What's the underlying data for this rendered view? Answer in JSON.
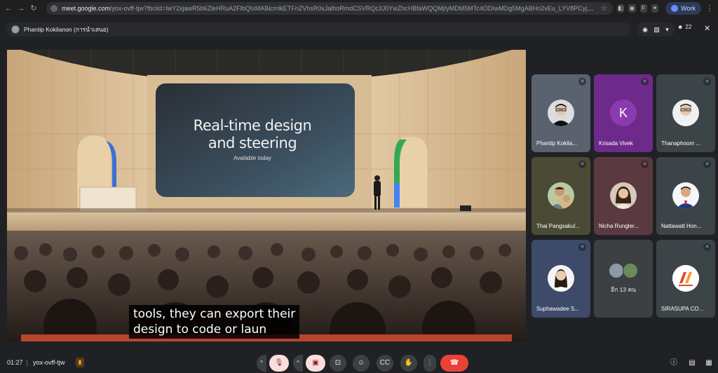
{
  "browser": {
    "url_host": "meet.google.com",
    "url_path": "/yox-ovff-tjw?fbclid=IwY2xjawR5b6ZleHRuA2FlbQIxMABicmlkETFnZVhsR0xJalhoRmdCSVRQc3J0YwZhcHBfaWQQMjIyMDM5MTc4ODIwMDg5MgABHo2vEu_LYV8PCyj-9xa79sHJwLU0LgEapQbKp...",
    "profile_label": "Work",
    "extensions": [
      "ext-a",
      "ext-b",
      "F",
      "ext-c"
    ]
  },
  "topbar": {
    "presenter_name": "Phantip Kokilanon (การนำเสนอ)",
    "participant_count": "22"
  },
  "stage": {
    "slide_title_line1": "Real-time design",
    "slide_title_line2": "and steering",
    "slide_subtitle": "Available today",
    "caption_line1": "tools, they can export their",
    "caption_line2": "design to code or laun"
  },
  "participants": [
    {
      "name": "Phantip Kokila...",
      "avatar": "photo-man-glasses",
      "bg": "#5a6270"
    },
    {
      "name": "Krisada Vivek",
      "avatar": "letter",
      "letter": "K",
      "bg": "#6e2a8a"
    },
    {
      "name": "Thanaphoom ...",
      "avatar": "photo-man-glasses",
      "bg": "#3c4448"
    },
    {
      "name": "Thai Pangsakul...",
      "avatar": "photo-man-dog",
      "bg": "#4a4a36"
    },
    {
      "name": "Nicha Rungler...",
      "avatar": "photo-woman",
      "bg": "#5a3a40"
    },
    {
      "name": "Nattawatt Hon...",
      "avatar": "photo-man-suit",
      "bg": "#3c4448"
    },
    {
      "name": "Suphawadee S...",
      "avatar": "photo-woman-white",
      "bg": "#3e4a6a"
    },
    {
      "name": "อีก 13 คน",
      "avatar": "stack",
      "bg": "#3c4043"
    },
    {
      "name": "SIRASUPA CO...",
      "avatar": "logo",
      "bg": "#3c4448"
    }
  ],
  "bottombar": {
    "time": "01:27",
    "meeting_code": "yox-ovff-tjw"
  },
  "colors": {
    "accent_blue": "#8ab4f8",
    "end_call_red": "#ea4335",
    "muted_pale": "#f9dedc"
  }
}
